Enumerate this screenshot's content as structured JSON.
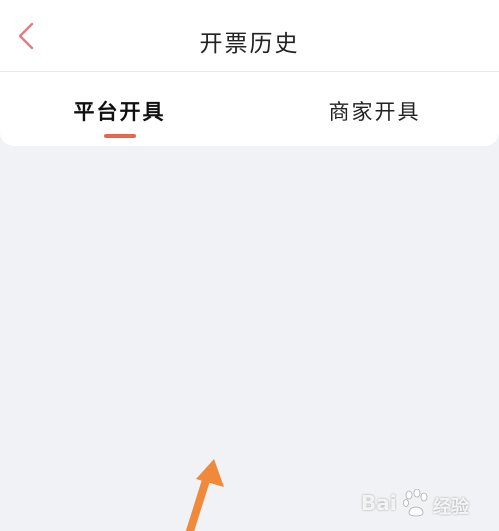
{
  "header": {
    "title": "开票历史",
    "back_icon": "chevron-left-icon",
    "back_color": "#e27d7d"
  },
  "tabs": [
    {
      "label": "平台开具",
      "active": true
    },
    {
      "label": "商家开具",
      "active": false
    }
  ],
  "colors": {
    "accent": "#e8664a",
    "background": "#f1f2f6",
    "arrow": "#f08a3a"
  },
  "watermark": {
    "brand_left": "Bai",
    "brand_right": "经验"
  }
}
